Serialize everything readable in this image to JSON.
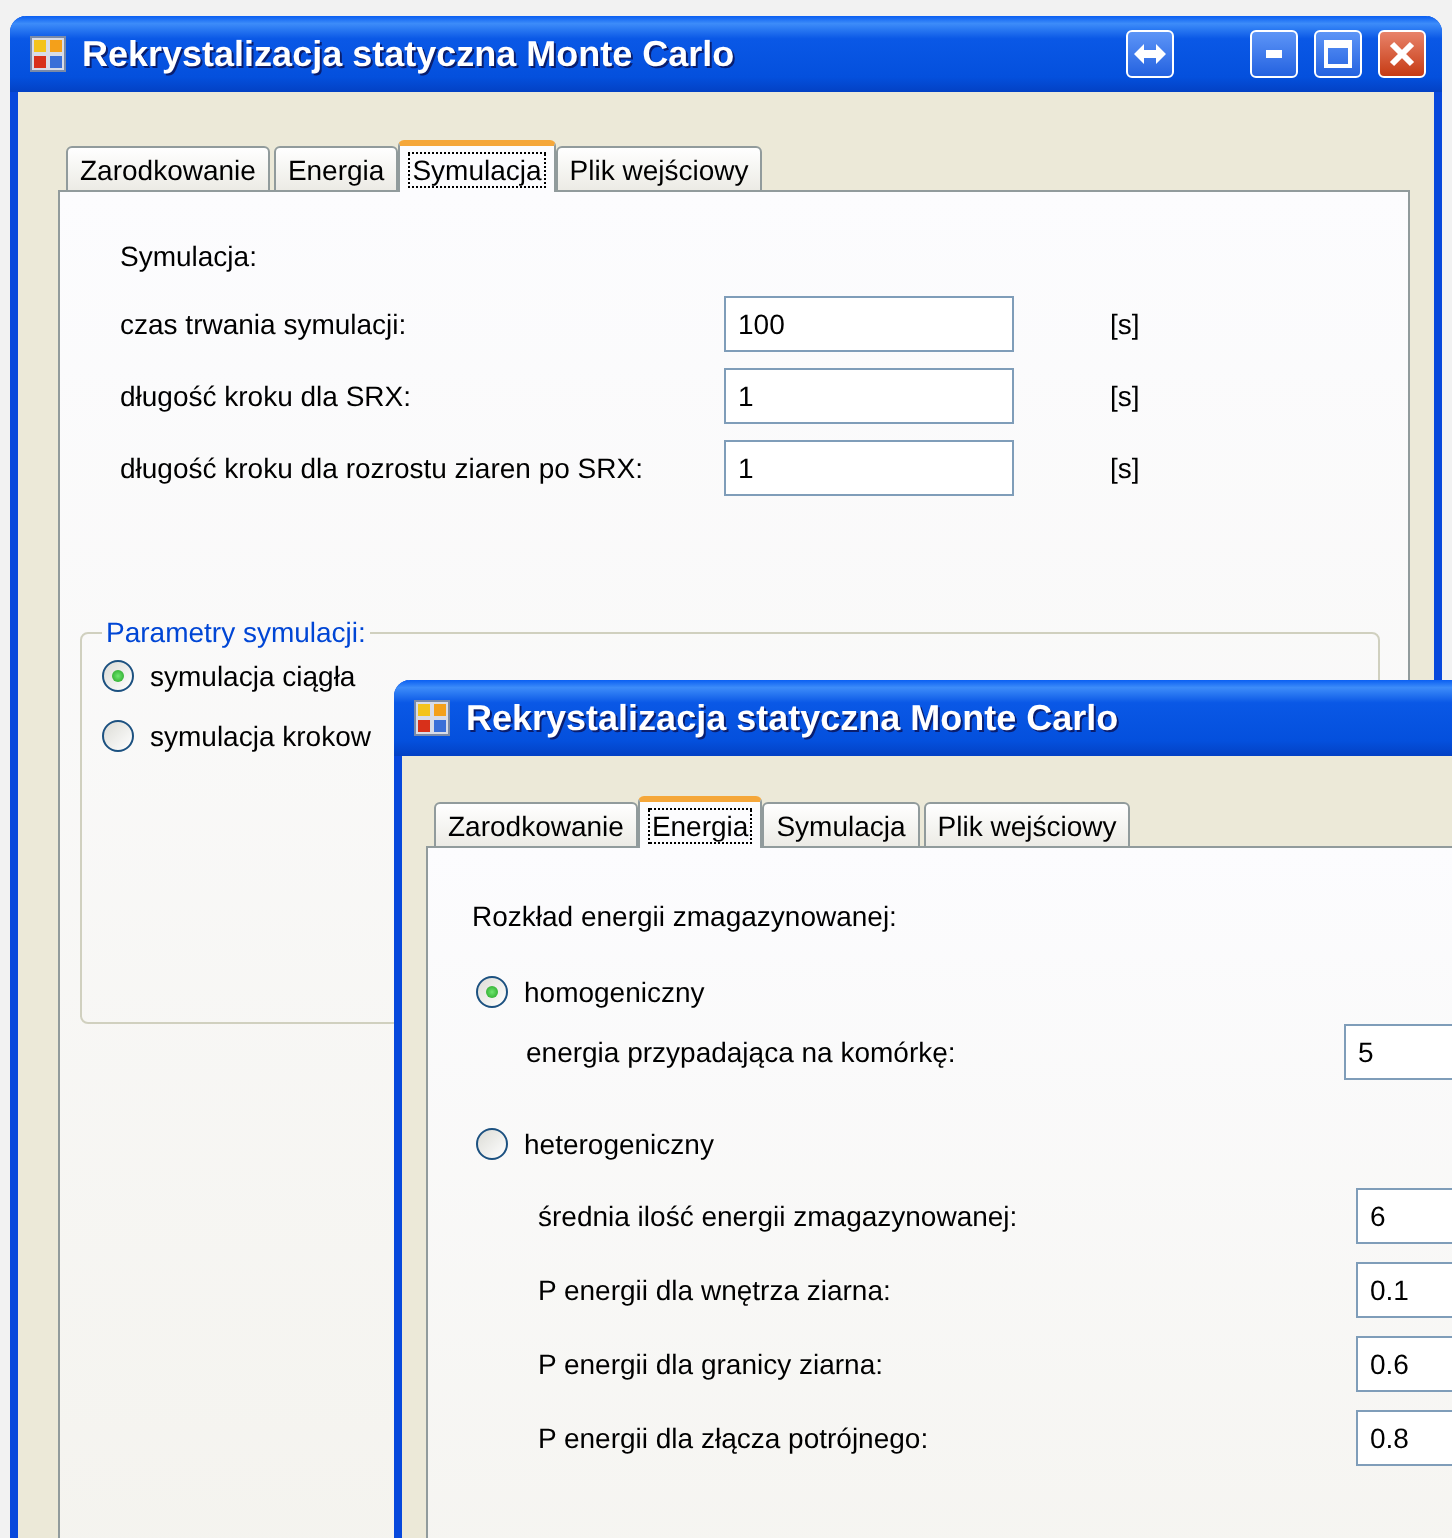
{
  "windows": [
    {
      "kind": "simulation",
      "title": "Rekrystalizacja statyczna Monte Carlo",
      "tabs": [
        {
          "label": "Zarodkowanie",
          "selected": false
        },
        {
          "label": "Energia",
          "selected": false
        },
        {
          "label": "Symulacja",
          "selected": true
        },
        {
          "label": "Plik wejściowy",
          "selected": false
        }
      ],
      "heading": "Symulacja:",
      "fields": [
        {
          "label": "czas trwania symulacji:",
          "value": "100",
          "unit": "[s]"
        },
        {
          "label": "długość kroku dla SRX:",
          "value": "1",
          "unit": "[s]"
        },
        {
          "label": "długość kroku dla rozrostu ziaren po SRX:",
          "value": "1",
          "unit": "[s]"
        }
      ],
      "group": {
        "title": "Parametry symulacji:",
        "options": [
          {
            "label": "symulacja ciągła",
            "selected": true
          },
          {
            "label": "symulacja krokow",
            "selected": false
          }
        ]
      }
    },
    {
      "kind": "energy",
      "title": "Rekrystalizacja statyczna Monte Carlo",
      "tabs": [
        {
          "label": "Zarodkowanie",
          "selected": false
        },
        {
          "label": "Energia",
          "selected": true
        },
        {
          "label": "Symulacja",
          "selected": false
        },
        {
          "label": "Plik wejściowy",
          "selected": false
        }
      ],
      "heading": "Rozkład energii zmagazynowanej:",
      "options": [
        {
          "label": "homogeniczny",
          "selected": true,
          "fields": [
            {
              "label": "energia przypadająca na komórkę:",
              "value": "5"
            }
          ]
        },
        {
          "label": "heterogeniczny",
          "selected": false,
          "fields": [
            {
              "label": "średnia ilość energii zmagazynowanej:",
              "value": "6"
            },
            {
              "label": "P energii dla wnętrza ziarna:",
              "value": "0.1"
            },
            {
              "label": "P energii dla granicy ziarna:",
              "value": "0.6"
            },
            {
              "label": "P energii dla złącza potrójnego:",
              "value": "0.8"
            }
          ]
        }
      ]
    }
  ]
}
